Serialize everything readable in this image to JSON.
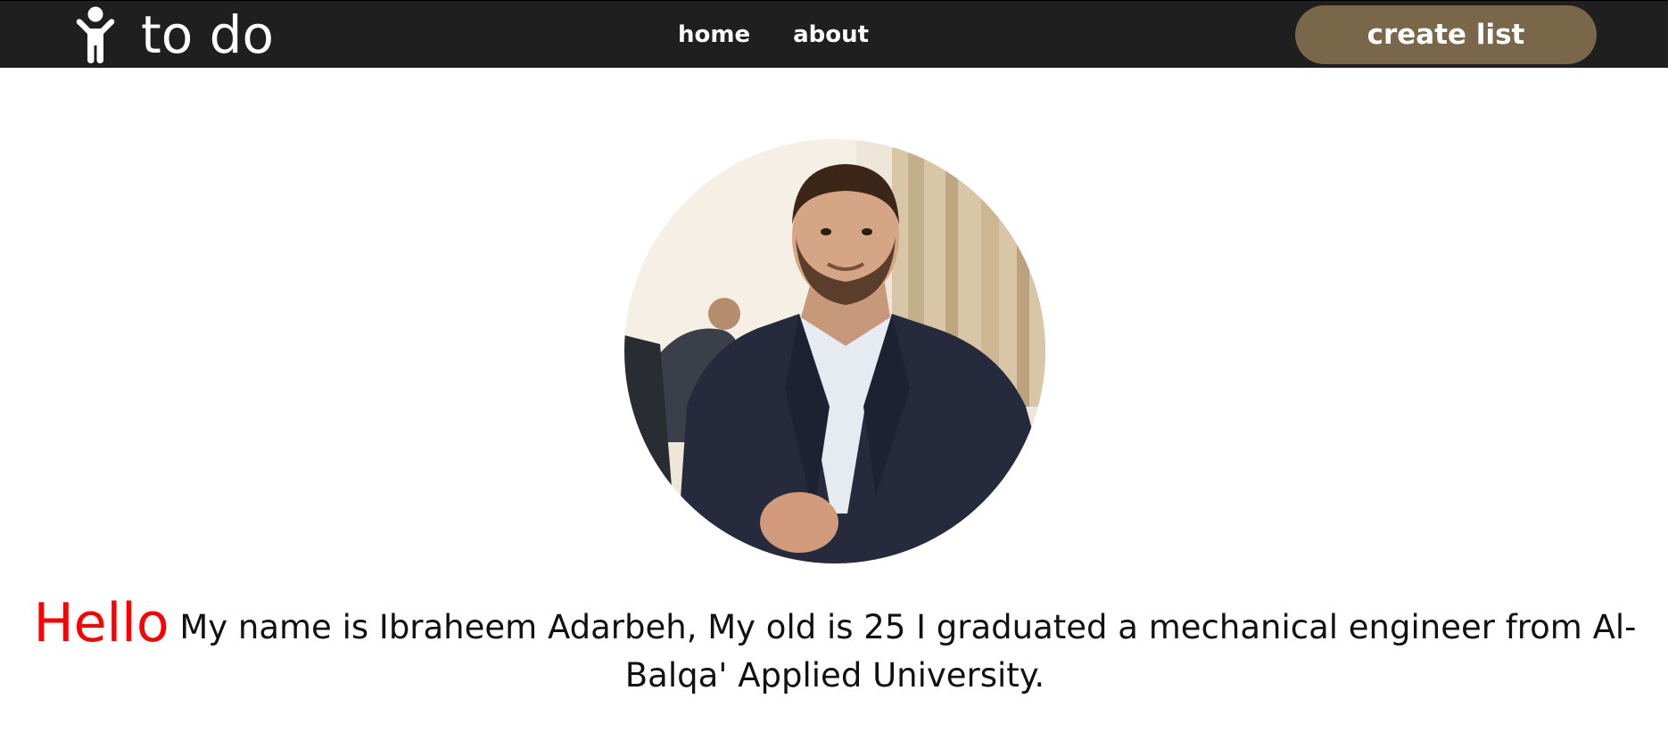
{
  "navbar": {
    "brand_icon": "person-standing-icon",
    "brand_name": "to do",
    "links": [
      {
        "label": "home"
      },
      {
        "label": "about"
      }
    ],
    "cta_label": "create list",
    "colors": {
      "background": "#1f1f1f",
      "cta_background": "#7a6648",
      "text": "#ffffff"
    }
  },
  "profile": {
    "avatar_alt": "profile-photo"
  },
  "intro": {
    "greeting": "Hello",
    "text": "My name is Ibraheem Adarbeh, My old is 25 I graduated a mechanical engineer from Al- Balqa' Applied University.",
    "greeting_color": "#ff0000"
  }
}
